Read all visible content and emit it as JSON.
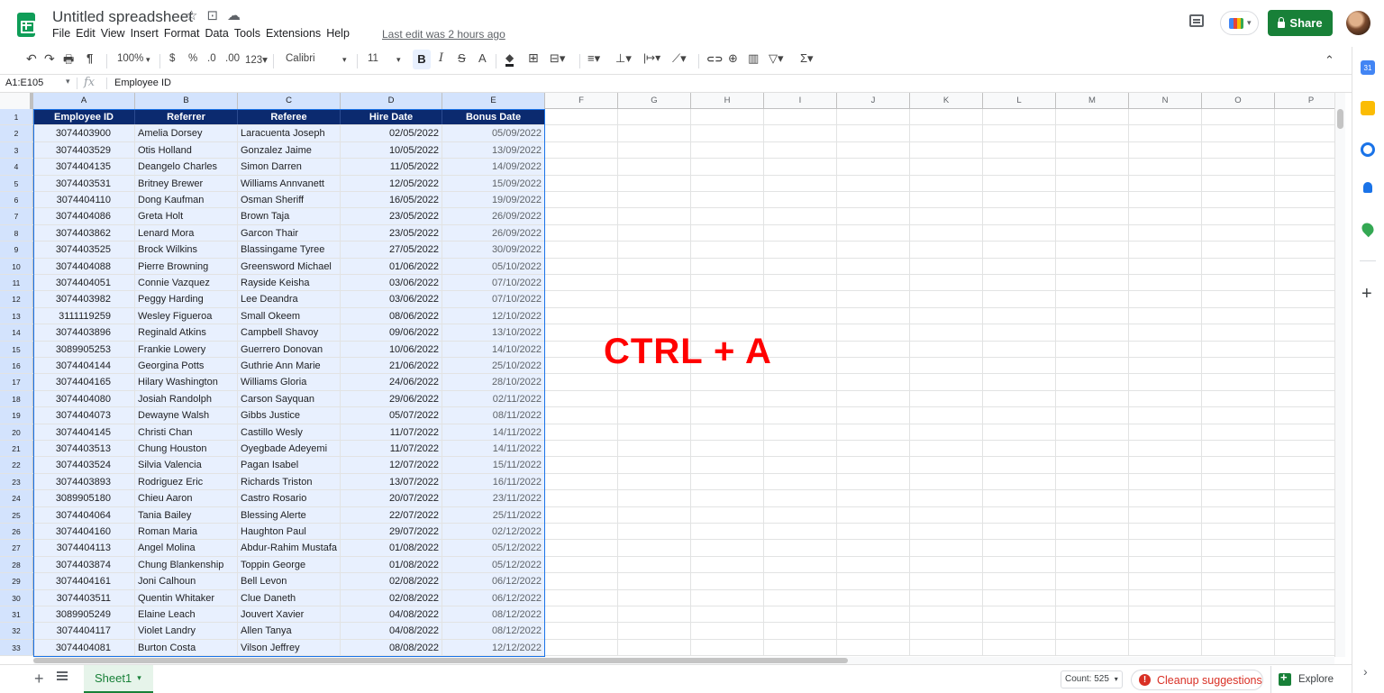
{
  "window": {
    "title": "Untitled spreadsheet",
    "menu": [
      "File",
      "Edit",
      "View",
      "Insert",
      "Format",
      "Data",
      "Tools",
      "Extensions",
      "Help"
    ],
    "last_edit": "Last edit was 2 hours ago",
    "share_label": "Share",
    "star_glyph": "☆",
    "move_glyph": "⊡",
    "cloud_glyph": "☁"
  },
  "toolbar": {
    "undo": "↶",
    "redo": "↷",
    "print": "🖶",
    "paint_format": "¶",
    "zoom": "100%",
    "zoom_arrow": "▾",
    "currency": "$",
    "percent": "%",
    "dec_decrease": ".0",
    "dec_increase": ".00",
    "more_formats": "123▾",
    "font": "Calibri",
    "font_arrow": "▾",
    "font_size": "11",
    "font_size_arrow": "▾",
    "bold": "B",
    "italic": "I",
    "strike": "S",
    "text_color": "A",
    "fill": "◆",
    "borders": "⊞",
    "merge": "⊟▾",
    "halign": "≡▾",
    "valign": "⊥▾",
    "wrap": "|↦▾",
    "rotate": "⟋▾",
    "link": "⊂⊃",
    "comment": "⊕",
    "chart": "▥",
    "filter": "▽▾",
    "functions": "Σ▾",
    "collapse": "⌃"
  },
  "formula_bar": {
    "name_box": "A1:E105",
    "name_arrow": "▾",
    "fx": "fx",
    "value": "Employee ID"
  },
  "columns": [
    "A",
    "B",
    "C",
    "D",
    "E",
    "F",
    "G",
    "H",
    "I",
    "J",
    "K",
    "L",
    "M",
    "N",
    "O",
    "P"
  ],
  "table": {
    "headers": [
      "Employee ID",
      "Referrer",
      "Referee",
      "Hire Date",
      "Bonus Date"
    ],
    "rows": [
      [
        "3074403900",
        "Amelia Dorsey",
        "Laracuenta Joseph",
        "02/05/2022",
        "05/09/2022"
      ],
      [
        "3074403529",
        "Otis Holland",
        "Gonzalez Jaime",
        "10/05/2022",
        "13/09/2022"
      ],
      [
        "3074404135",
        "Deangelo Charles",
        "Simon Darren",
        "11/05/2022",
        "14/09/2022"
      ],
      [
        "3074403531",
        "Britney Brewer",
        "Williams Annvanett",
        "12/05/2022",
        "15/09/2022"
      ],
      [
        "3074404110",
        "Dong Kaufman",
        "Osman Sheriff",
        "16/05/2022",
        "19/09/2022"
      ],
      [
        "3074404086",
        "Greta Holt",
        "Brown Taja",
        "23/05/2022",
        "26/09/2022"
      ],
      [
        "3074403862",
        "Lenard Mora",
        "Garcon Thair",
        "23/05/2022",
        "26/09/2022"
      ],
      [
        "3074403525",
        "Brock Wilkins",
        "Blassingame Tyree",
        "27/05/2022",
        "30/09/2022"
      ],
      [
        "3074404088",
        "Pierre Browning",
        "Greensword Michael",
        "01/06/2022",
        "05/10/2022"
      ],
      [
        "3074404051",
        "Connie Vazquez",
        "Rayside Keisha",
        "03/06/2022",
        "07/10/2022"
      ],
      [
        "3074403982",
        "Peggy Harding",
        "Lee Deandra",
        "03/06/2022",
        "07/10/2022"
      ],
      [
        "3111119259",
        "Wesley Figueroa",
        "Small Okeem",
        "08/06/2022",
        "12/10/2022"
      ],
      [
        "3074403896",
        "Reginald Atkins",
        "Campbell Shavoy",
        "09/06/2022",
        "13/10/2022"
      ],
      [
        "3089905253",
        "Frankie Lowery",
        "Guerrero Donovan",
        "10/06/2022",
        "14/10/2022"
      ],
      [
        "3074404144",
        "Georgina Potts",
        "Guthrie Ann Marie",
        "21/06/2022",
        "25/10/2022"
      ],
      [
        "3074404165",
        "Hilary Washington",
        "Williams Gloria",
        "24/06/2022",
        "28/10/2022"
      ],
      [
        "3074404080",
        "Josiah Randolph",
        "Carson Sayquan",
        "29/06/2022",
        "02/11/2022"
      ],
      [
        "3074404073",
        "Dewayne Walsh",
        "Gibbs Justice",
        "05/07/2022",
        "08/11/2022"
      ],
      [
        "3074404145",
        "Christi Chan",
        "Castillo Wesly",
        "11/07/2022",
        "14/11/2022"
      ],
      [
        "3074403513",
        "Chung Houston",
        "Oyegbade Adeyemi",
        "11/07/2022",
        "14/11/2022"
      ],
      [
        "3074403524",
        "Silvia Valencia",
        "Pagan Isabel",
        "12/07/2022",
        "15/11/2022"
      ],
      [
        "3074403893",
        "Rodriguez Eric",
        "Richards Triston",
        "13/07/2022",
        "16/11/2022"
      ],
      [
        "3089905180",
        "Chieu Aaron",
        "Castro Rosario",
        "20/07/2022",
        "23/11/2022"
      ],
      [
        "3074404064",
        "Tania Bailey",
        "Blessing Alerte",
        "22/07/2022",
        "25/11/2022"
      ],
      [
        "3074404160",
        "Roman Maria",
        "Haughton Paul",
        "29/07/2022",
        "02/12/2022"
      ],
      [
        "3074404113",
        "Angel Molina",
        "Abdur-Rahim Mustafa",
        "01/08/2022",
        "05/12/2022"
      ],
      [
        "3074403874",
        "Chung Blankenship",
        "Toppin George",
        "01/08/2022",
        "05/12/2022"
      ],
      [
        "3074404161",
        "Joni Calhoun",
        "Bell Levon",
        "02/08/2022",
        "06/12/2022"
      ],
      [
        "3074403511",
        "Quentin Whitaker",
        "Clue Daneth",
        "02/08/2022",
        "06/12/2022"
      ],
      [
        "3089905249",
        "Elaine Leach",
        "Jouvert Xavier",
        "04/08/2022",
        "08/12/2022"
      ],
      [
        "3074404117",
        "Violet Landry",
        "Allen Tanya",
        "04/08/2022",
        "08/12/2022"
      ],
      [
        "3074404081",
        "Burton Costa",
        "Vilson Jeffrey",
        "08/08/2022",
        "12/12/2022"
      ]
    ]
  },
  "overlay": "CTRL + A",
  "bottom": {
    "add_sheet": "+",
    "sheet_name": "Sheet1",
    "sheet_arrow": "▾",
    "count": "Count: 525",
    "count_arrow": "▾",
    "cleanup": "Cleanup suggestions",
    "alert_glyph": "!",
    "explore": "Explore",
    "side_toggle": "›"
  },
  "side_panel": {
    "add": "+",
    "calendar_label": "31"
  },
  "colors": {
    "header_fill": "#0b2a6f",
    "selection": "#1a73e8",
    "share": "#188038",
    "overlay": "#ff0000"
  }
}
